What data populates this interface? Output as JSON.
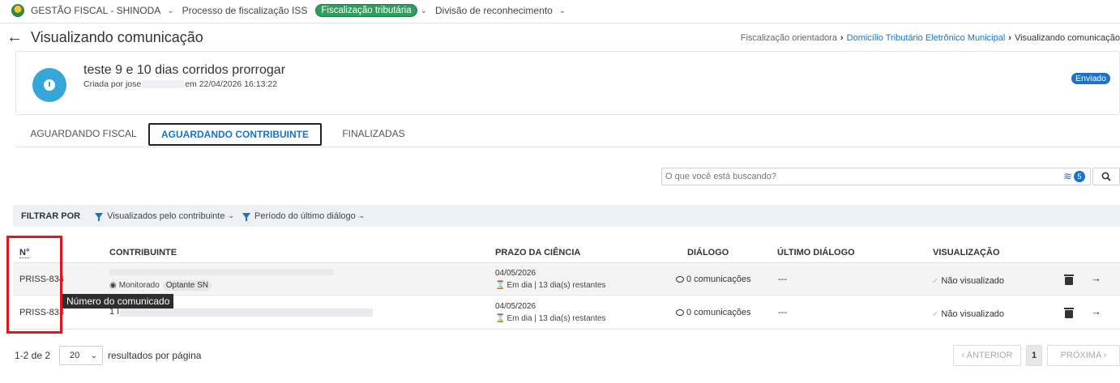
{
  "topnav": {
    "app": "GESTÃO FISCAL - SHINODA",
    "process": "Processo de fiscalização ISS",
    "active": "Fiscalização tributária",
    "division": "Divisão de reconhecimento"
  },
  "header": {
    "title": "Visualizando comunicação",
    "breadcrumb": [
      "Fiscalização orientadora",
      "Domicílio Tributário Eletrônico Municipal",
      "Visualizando comunicação"
    ]
  },
  "card": {
    "title": "teste 9 e 10 dias corridos prorrogar",
    "created_prefix": "Criada por jose",
    "created_suffix": "em 22/04/2026 16:13:22",
    "status": "Enviado"
  },
  "tabs": [
    "AGUARDANDO FISCAL",
    "AGUARDANDO CONTRIBUINTE",
    "FINALIZADAS"
  ],
  "search": {
    "placeholder": "O que você está buscando?",
    "filter_count": "5"
  },
  "filters": {
    "label": "FILTRAR POR",
    "items": [
      "Visualizados pelo contribuinte",
      "Período do último diálogo"
    ]
  },
  "table": {
    "headers": [
      "N°",
      "CONTRIBUINTE",
      "PRAZO DA CIÊNCIA",
      "DIÁLOGO",
      "ÚLTIMO DIÁLOGO",
      "VISUALIZAÇÃO"
    ],
    "rows": [
      {
        "id": "PRISS-834",
        "monitor": "Monitorado",
        "tag": "Optante SN",
        "date": "04/05/2026",
        "deadline": "Em dia | 13 dia(s) restantes",
        "dialog": "0 comunicações",
        "last": "---",
        "view": "Não visualizado"
      },
      {
        "id": "PRISS-833",
        "contrib_prefix": "1 I",
        "date": "04/05/2026",
        "deadline": "Em dia | 13 dia(s) restantes",
        "dialog": "0 comunicações",
        "last": "---",
        "view": "Não visualizado"
      }
    ]
  },
  "tooltip": "Número do comunicado",
  "pagination": {
    "range": "1-2 de 2",
    "per_page": "20",
    "per_page_label": "resultados por página",
    "prev": "‹ ANTERIOR",
    "page": "1",
    "next": "PRÓXIMA ›"
  }
}
